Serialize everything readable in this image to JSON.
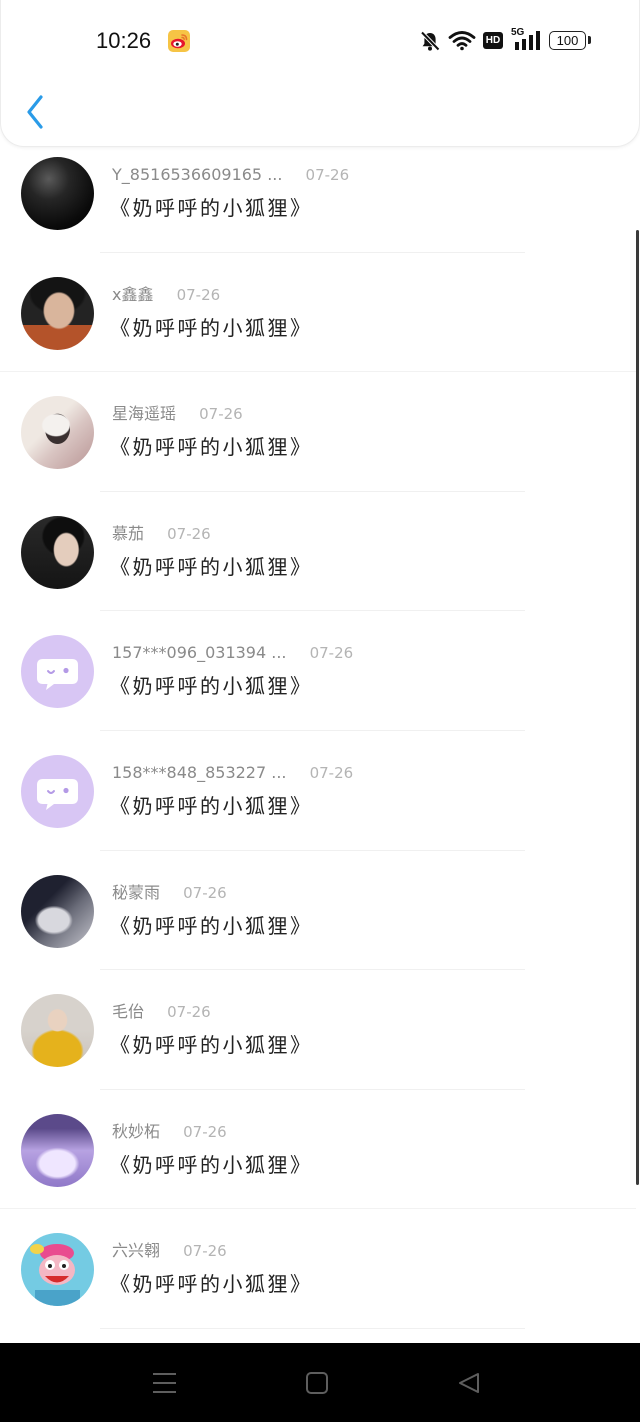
{
  "status_bar": {
    "time": "10:26",
    "hd_label": "HD",
    "network_label": "5G",
    "battery_level": "100",
    "icons": {
      "app": "weibo-icon",
      "notifications": "mute-bell-icon",
      "wifi": "wifi-icon",
      "signal": "signal-bars-icon"
    }
  },
  "header": {
    "back_icon": "back-chevron-icon"
  },
  "list": {
    "items": [
      {
        "name": "Y_8516536609165 ...",
        "date": "07-26",
        "title": "《奶呼呼的小狐狸》"
      },
      {
        "name": "x鑫鑫",
        "date": "07-26",
        "title": "《奶呼呼的小狐狸》"
      },
      {
        "name": "星海遥瑶",
        "date": "07-26",
        "title": "《奶呼呼的小狐狸》"
      },
      {
        "name": "慕茄",
        "date": "07-26",
        "title": "《奶呼呼的小狐狸》"
      },
      {
        "name": "157***096_031394 ...",
        "date": "07-26",
        "title": "《奶呼呼的小狐狸》",
        "avatar_icon": "chat-bubble-face-icon"
      },
      {
        "name": "158***848_853227 ...",
        "date": "07-26",
        "title": "《奶呼呼的小狐狸》",
        "avatar_icon": "chat-bubble-face-icon"
      },
      {
        "name": "秘蒙雨",
        "date": "07-26",
        "title": "《奶呼呼的小狐狸》"
      },
      {
        "name": "毛佁",
        "date": "07-26",
        "title": "《奶呼呼的小狐狸》"
      },
      {
        "name": "秋妙柘",
        "date": "07-26",
        "title": "《奶呼呼的小狐狸》"
      },
      {
        "name": "六兴翱",
        "date": "07-26",
        "title": "《奶呼呼的小狐狸》"
      }
    ]
  },
  "nav_bar": {
    "menu": "menu-icon",
    "home": "home-square-icon",
    "back": "back-triangle-icon"
  },
  "colors": {
    "accent": "#2a9be8",
    "nav_background": "#000000",
    "avatar_placeholder": "#d8c6f4"
  }
}
